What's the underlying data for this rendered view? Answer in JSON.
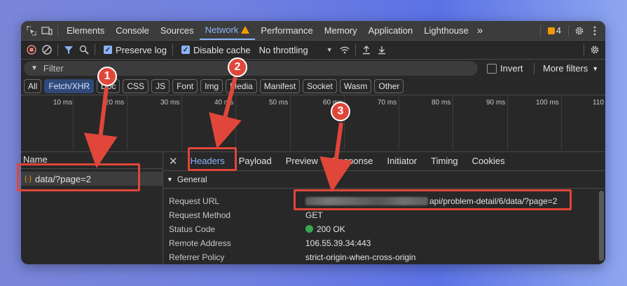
{
  "tabs": {
    "items": [
      "Elements",
      "Console",
      "Sources",
      "Network",
      "Performance",
      "Memory",
      "Application",
      "Lighthouse"
    ],
    "active": "Network",
    "more": "»",
    "issues_count": "4"
  },
  "toolbar": {
    "preserve_log": "Preserve log",
    "disable_cache": "Disable cache",
    "throttling": "No throttling"
  },
  "filter": {
    "placeholder": "Filter",
    "invert": "Invert",
    "more_filters": "More filters"
  },
  "types": [
    "All",
    "Fetch/XHR",
    "Doc",
    "CSS",
    "JS",
    "Font",
    "Img",
    "Media",
    "Manifest",
    "Socket",
    "Wasm",
    "Other"
  ],
  "active_type": "Fetch/XHR",
  "timeline": {
    "ticks": [
      "10 ms",
      "20 ms",
      "30 ms",
      "40 ms",
      "50 ms",
      "60 ms",
      "70 ms",
      "80 ms",
      "90 ms",
      "100 ms",
      "110"
    ]
  },
  "list": {
    "header": "Name",
    "request": "data/?page=2"
  },
  "details": {
    "tabs": [
      "Headers",
      "Payload",
      "Preview",
      "Response",
      "Initiator",
      "Timing",
      "Cookies"
    ],
    "active": "Headers",
    "section": "General",
    "rows": [
      {
        "key": "Request URL",
        "value": "api/problem-detail/6/data/?page=2"
      },
      {
        "key": "Request Method",
        "value": "GET"
      },
      {
        "key": "Status Code",
        "value": "200 OK"
      },
      {
        "key": "Remote Address",
        "value": "106.55.39.34:443"
      },
      {
        "key": "Referrer Policy",
        "value": "strict-origin-when-cross-origin"
      }
    ]
  },
  "annotations": [
    "1",
    "2",
    "3"
  ],
  "colors": {
    "accent": "#8ab4f8",
    "annotation": "#e0463a",
    "status_ok": "#34a853"
  }
}
